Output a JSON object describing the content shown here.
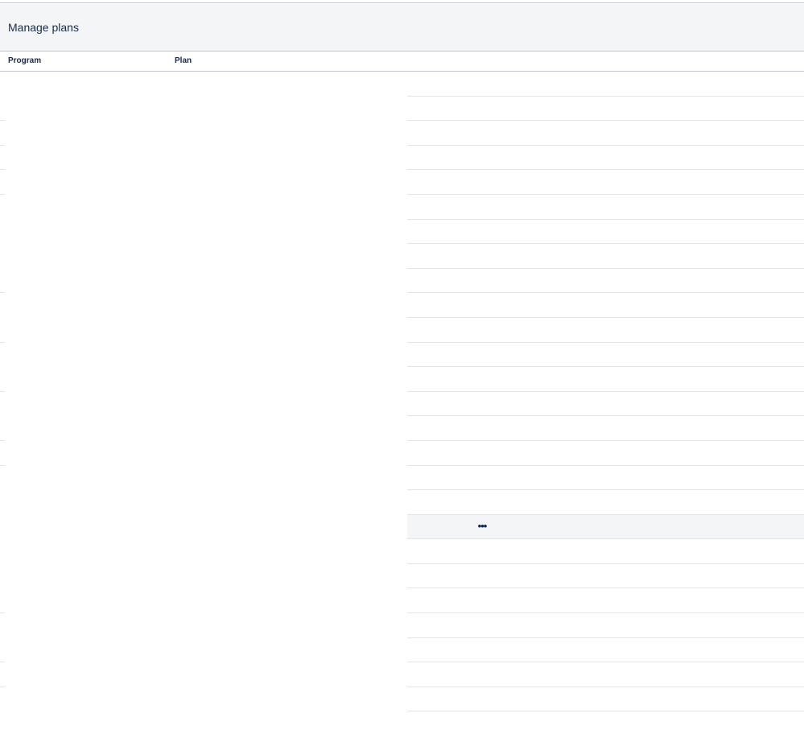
{
  "header": {
    "title": "Manage plans"
  },
  "table": {
    "columns": [
      {
        "key": "program",
        "label": "Program"
      },
      {
        "key": "plan",
        "label": "Plan"
      }
    ],
    "rows": [
      {
        "program": "",
        "plan": "",
        "left_tick": false,
        "highlighted": false
      },
      {
        "program": "",
        "plan": "",
        "left_tick": true,
        "highlighted": false
      },
      {
        "program": "",
        "plan": "",
        "left_tick": true,
        "highlighted": false
      },
      {
        "program": "",
        "plan": "",
        "left_tick": true,
        "highlighted": false
      },
      {
        "program": "",
        "plan": "",
        "left_tick": true,
        "highlighted": false
      },
      {
        "program": "",
        "plan": "",
        "left_tick": false,
        "highlighted": false
      },
      {
        "program": "",
        "plan": "",
        "left_tick": false,
        "highlighted": false
      },
      {
        "program": "",
        "plan": "",
        "left_tick": false,
        "highlighted": false
      },
      {
        "program": "",
        "plan": "",
        "left_tick": true,
        "highlighted": false
      },
      {
        "program": "",
        "plan": "",
        "left_tick": false,
        "highlighted": false
      },
      {
        "program": "",
        "plan": "",
        "left_tick": true,
        "highlighted": false
      },
      {
        "program": "",
        "plan": "",
        "left_tick": false,
        "highlighted": false
      },
      {
        "program": "",
        "plan": "",
        "left_tick": true,
        "highlighted": false
      },
      {
        "program": "",
        "plan": "",
        "left_tick": false,
        "highlighted": false
      },
      {
        "program": "",
        "plan": "",
        "left_tick": true,
        "highlighted": false
      },
      {
        "program": "",
        "plan": "",
        "left_tick": true,
        "highlighted": false
      },
      {
        "program": "",
        "plan": "",
        "left_tick": false,
        "highlighted": false
      },
      {
        "program": "",
        "plan": "",
        "left_tick": false,
        "highlighted": false
      },
      {
        "program": "",
        "plan": "",
        "left_tick": false,
        "highlighted": true
      },
      {
        "program": "",
        "plan": "",
        "left_tick": false,
        "highlighted": false
      },
      {
        "program": "",
        "plan": "",
        "left_tick": false,
        "highlighted": false
      },
      {
        "program": "",
        "plan": "",
        "left_tick": true,
        "highlighted": false
      },
      {
        "program": "",
        "plan": "",
        "left_tick": false,
        "highlighted": false
      },
      {
        "program": "",
        "plan": "",
        "left_tick": true,
        "highlighted": false
      },
      {
        "program": "",
        "plan": "",
        "left_tick": true,
        "highlighted": false
      },
      {
        "program": "",
        "plan": "",
        "left_tick": false,
        "highlighted": false
      }
    ]
  },
  "row_actions": {
    "icon": "more-horizontal-icon",
    "label": "•••"
  },
  "colors": {
    "header_bg": "#f4f5f7",
    "text": "#172b4d",
    "divider": "#c1c7d0",
    "row_line": "#e1e4e8",
    "highlight_bg": "#f4f5f7"
  }
}
